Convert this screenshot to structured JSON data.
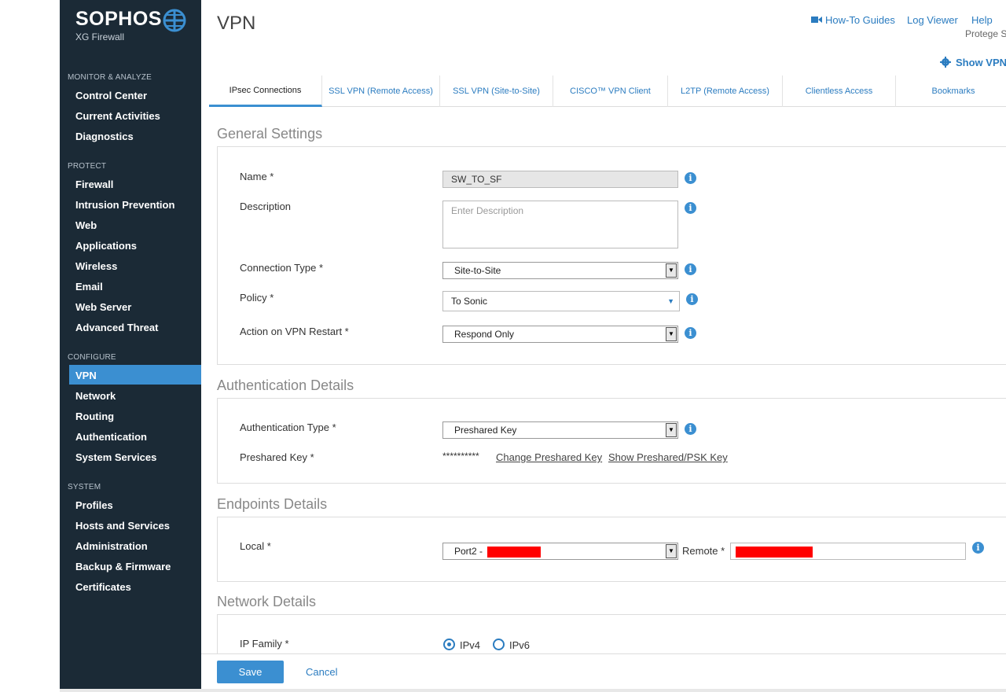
{
  "sidebar": {
    "logo": "SOPHOS",
    "product": "XG Firewall",
    "sections": [
      {
        "title": "MONITOR & ANALYZE",
        "items": [
          "Control Center",
          "Current Activities",
          "Diagnostics"
        ]
      },
      {
        "title": "PROTECT",
        "items": [
          "Firewall",
          "Intrusion Prevention",
          "Web",
          "Applications",
          "Wireless",
          "Email",
          "Web Server",
          "Advanced Threat"
        ]
      },
      {
        "title": "CONFIGURE",
        "items": [
          "VPN",
          "Network",
          "Routing",
          "Authentication",
          "System Services"
        ]
      },
      {
        "title": "SYSTEM",
        "items": [
          "Profiles",
          "Hosts and Services",
          "Administration",
          "Backup & Firmware",
          "Certificates"
        ]
      }
    ],
    "active_item": "VPN"
  },
  "header": {
    "title": "VPN",
    "links": [
      "How-To Guides",
      "Log Viewer",
      "Help"
    ],
    "user": "Protege S",
    "show_vpn": "Show VPN S"
  },
  "tabs": [
    "IPsec Connections",
    "SSL VPN (Remote Access)",
    "SSL VPN (Site-to-Site)",
    "CISCO™ VPN Client",
    "L2TP (Remote Access)",
    "Clientless Access",
    "Bookmarks"
  ],
  "active_tab": "IPsec Connections",
  "general": {
    "title": "General Settings",
    "name_label": "Name *",
    "name_value": "SW_TO_SF",
    "description_label": "Description",
    "description_placeholder": "Enter Description",
    "connection_type_label": "Connection Type *",
    "connection_type_value": "Site-to-Site",
    "policy_label": "Policy *",
    "policy_value": "To Sonic",
    "restart_label": "Action on VPN Restart *",
    "restart_value": "Respond Only"
  },
  "auth": {
    "title": "Authentication Details",
    "type_label": "Authentication Type *",
    "type_value": "Preshared Key",
    "key_label": "Preshared Key *",
    "key_mask": "**********",
    "change_link": "Change Preshared Key",
    "show_link": "Show Preshared/PSK Key"
  },
  "endpoints": {
    "title": "Endpoints Details",
    "local_label": "Local *",
    "local_value": "Port2 -",
    "remote_label": "Remote *"
  },
  "network": {
    "title": "Network Details",
    "ip_family_label": "IP Family *",
    "ipv4": "IPv4",
    "ipv6": "IPv6",
    "selected": "IPv4"
  },
  "footer": {
    "save": "Save",
    "cancel": "Cancel"
  },
  "colors": {
    "sidebar_bg": "#1b2a36",
    "accent": "#3b8fd1",
    "link": "#2b7cc0",
    "redaction": "#ff0000"
  }
}
